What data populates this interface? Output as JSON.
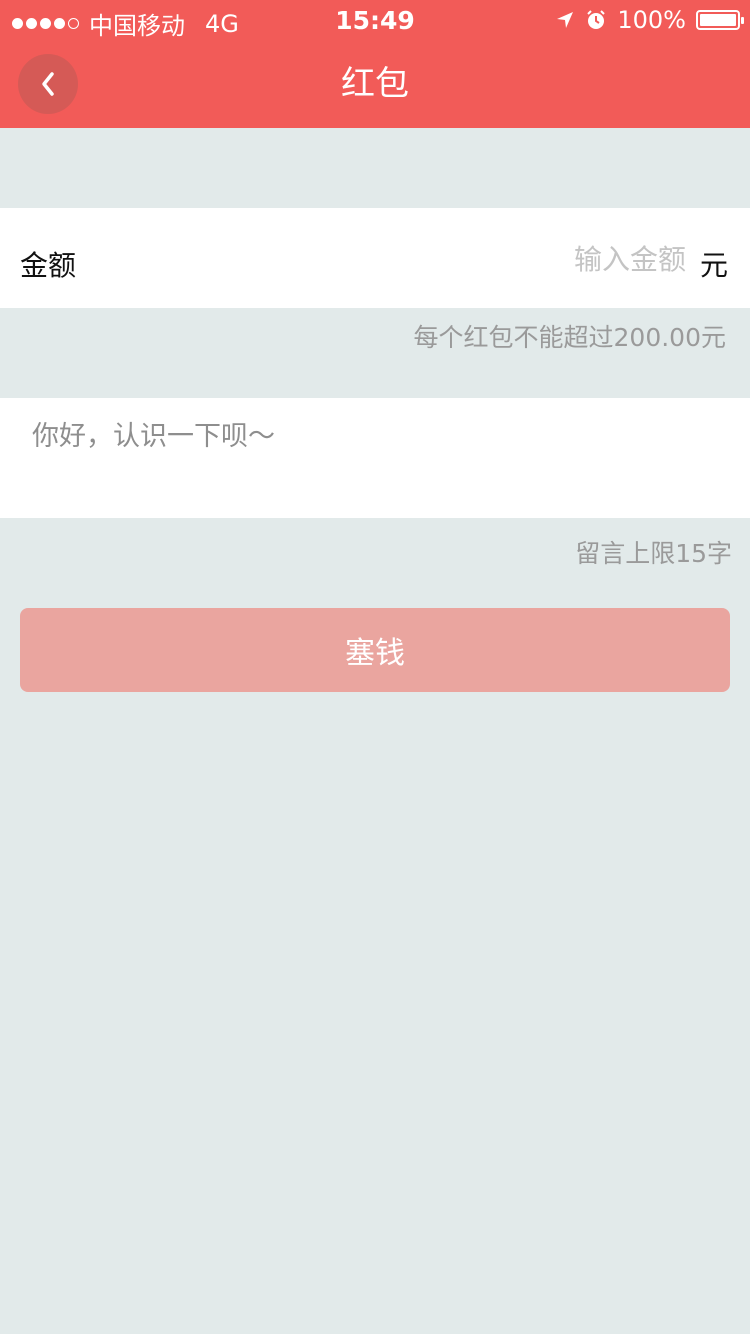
{
  "status_bar": {
    "carrier": "中国移动",
    "network": "4G",
    "time": "15:49",
    "battery": "100%"
  },
  "header": {
    "title": "红包",
    "background": "#f25b58"
  },
  "amount": {
    "label": "金额",
    "placeholder": "输入金额",
    "value": "",
    "unit": "元",
    "hint": "每个红包不能超过200.00元"
  },
  "message": {
    "placeholder": "你好，认识一下呗～",
    "value": "",
    "hint": "留言上限15字"
  },
  "submit": {
    "label": "塞钱",
    "color": "#eaa59f"
  }
}
